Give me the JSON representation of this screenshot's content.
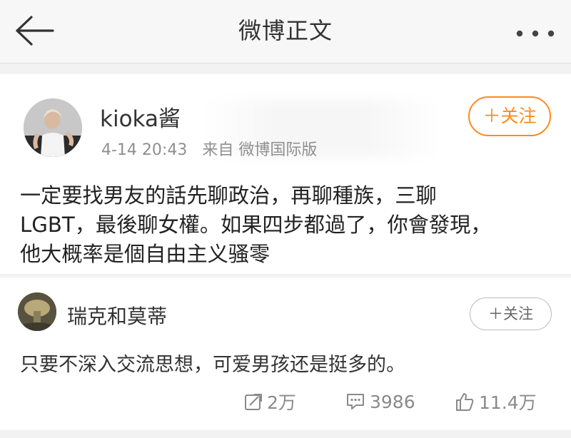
{
  "nav": {
    "title": "微博正文",
    "back_icon": "arrow-left-icon",
    "more_icon": "more-dots-icon"
  },
  "post": {
    "author": "kioka酱",
    "timestamp": "4-14 20:43",
    "source": "来自 微博国际版",
    "follow_label": "＋关注",
    "text_lines": [
      "一定要找男友的話先聊政治，再聊種族，三聊",
      "LGBT，最後聊女權。如果四步都過了，你會發現，",
      "他大概率是個自由主义骚零"
    ]
  },
  "comment": {
    "author": "瑞克和莫蒂",
    "follow_label": "＋关注",
    "text": "只要不深入交流思想，可爱男孩还是挺多的。",
    "actions": {
      "repost": "2万",
      "comments": "3986",
      "likes": "11.4万"
    }
  },
  "colors": {
    "accent": "#ff8a1f",
    "meta_text": "#8f8f8f",
    "background": "#f2f2f2"
  }
}
